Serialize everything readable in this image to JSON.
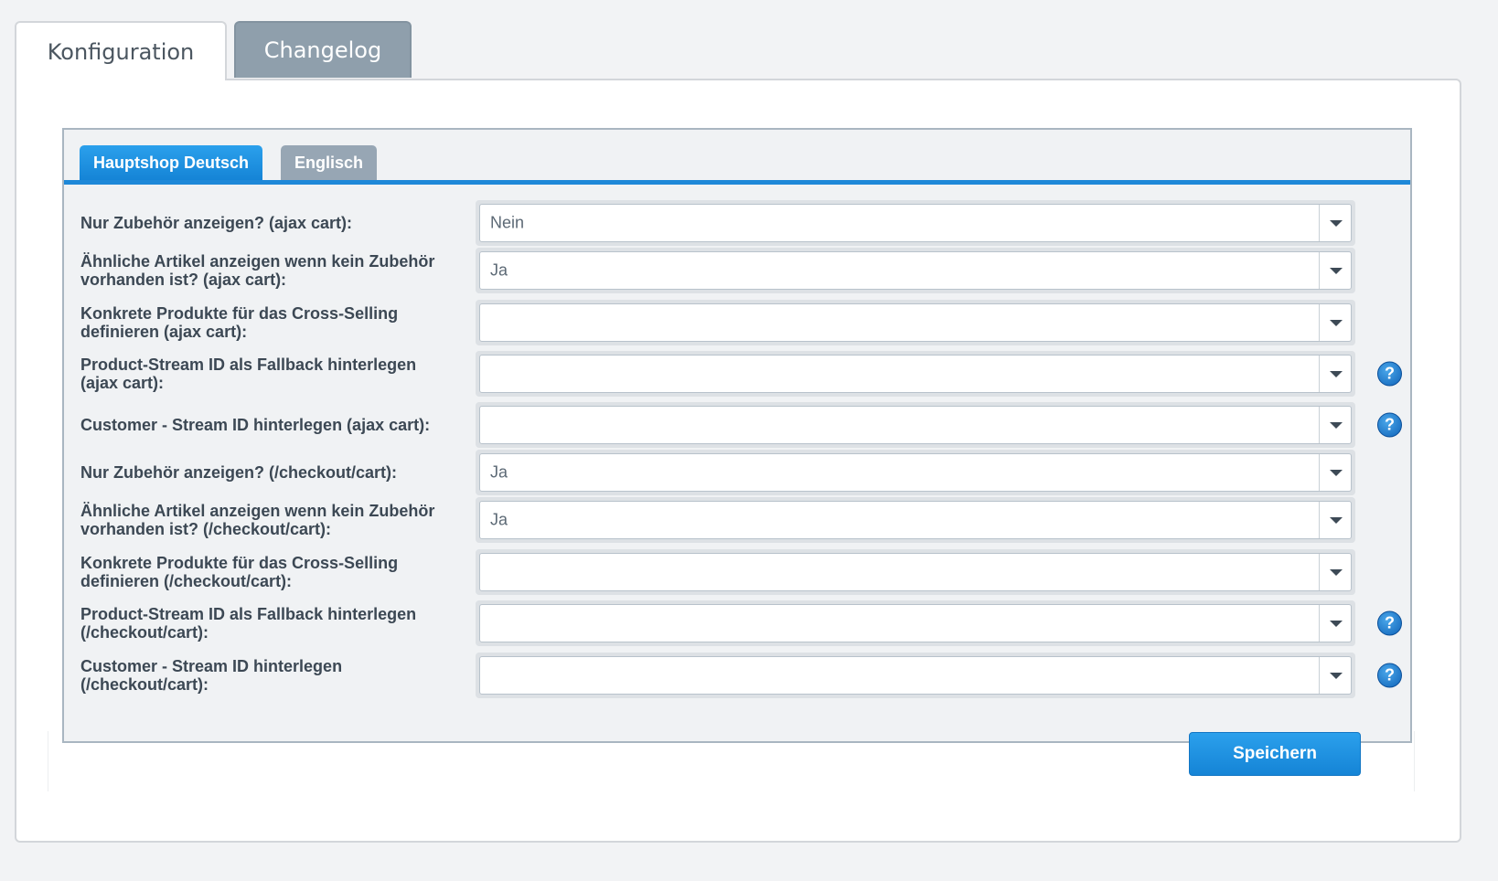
{
  "outer_tabs": [
    {
      "label": "Konfiguration",
      "active": true
    },
    {
      "label": "Changelog",
      "active": false
    }
  ],
  "inner_tabs": [
    {
      "label": "Hauptshop Deutsch",
      "active": true
    },
    {
      "label": "Englisch",
      "active": false
    }
  ],
  "form": {
    "rows": [
      {
        "label": "Nur Zubehör anzeigen? (ajax cart):",
        "value": "Nein",
        "help": false
      },
      {
        "label": "Ähnliche Artikel anzeigen wenn kein Zubehör vorhanden ist? (ajax cart):",
        "value": "Ja",
        "help": false
      },
      {
        "label": "Konkrete Produkte für das Cross-Selling definieren (ajax cart):",
        "value": "",
        "help": false
      },
      {
        "label": "Product-Stream ID als Fallback hinterlegen (ajax cart):",
        "value": "",
        "help": true
      },
      {
        "label": "Customer - Stream ID hinterlegen (ajax cart):",
        "value": "",
        "help": true
      },
      {
        "label": "Nur Zubehör anzeigen? (/checkout/cart):",
        "value": "Ja",
        "help": false
      },
      {
        "label": "Ähnliche Artikel anzeigen wenn kein Zubehör vorhanden ist? (/checkout/cart):",
        "value": "Ja",
        "help": false
      },
      {
        "label": "Konkrete Produkte für das Cross-Selling definieren (/checkout/cart):",
        "value": "",
        "help": false
      },
      {
        "label": "Product-Stream ID als Fallback hinterlegen (/checkout/cart):",
        "value": "",
        "help": true
      },
      {
        "label": "Customer - Stream ID hinterlegen (/checkout/cart):",
        "value": "",
        "help": true
      }
    ],
    "help_glyph": "?"
  },
  "actions": {
    "save_label": "Speichern"
  },
  "colors": {
    "accent": "#1e88d8",
    "tab_inactive": "#8f9fac",
    "label_text": "#3c4854"
  }
}
